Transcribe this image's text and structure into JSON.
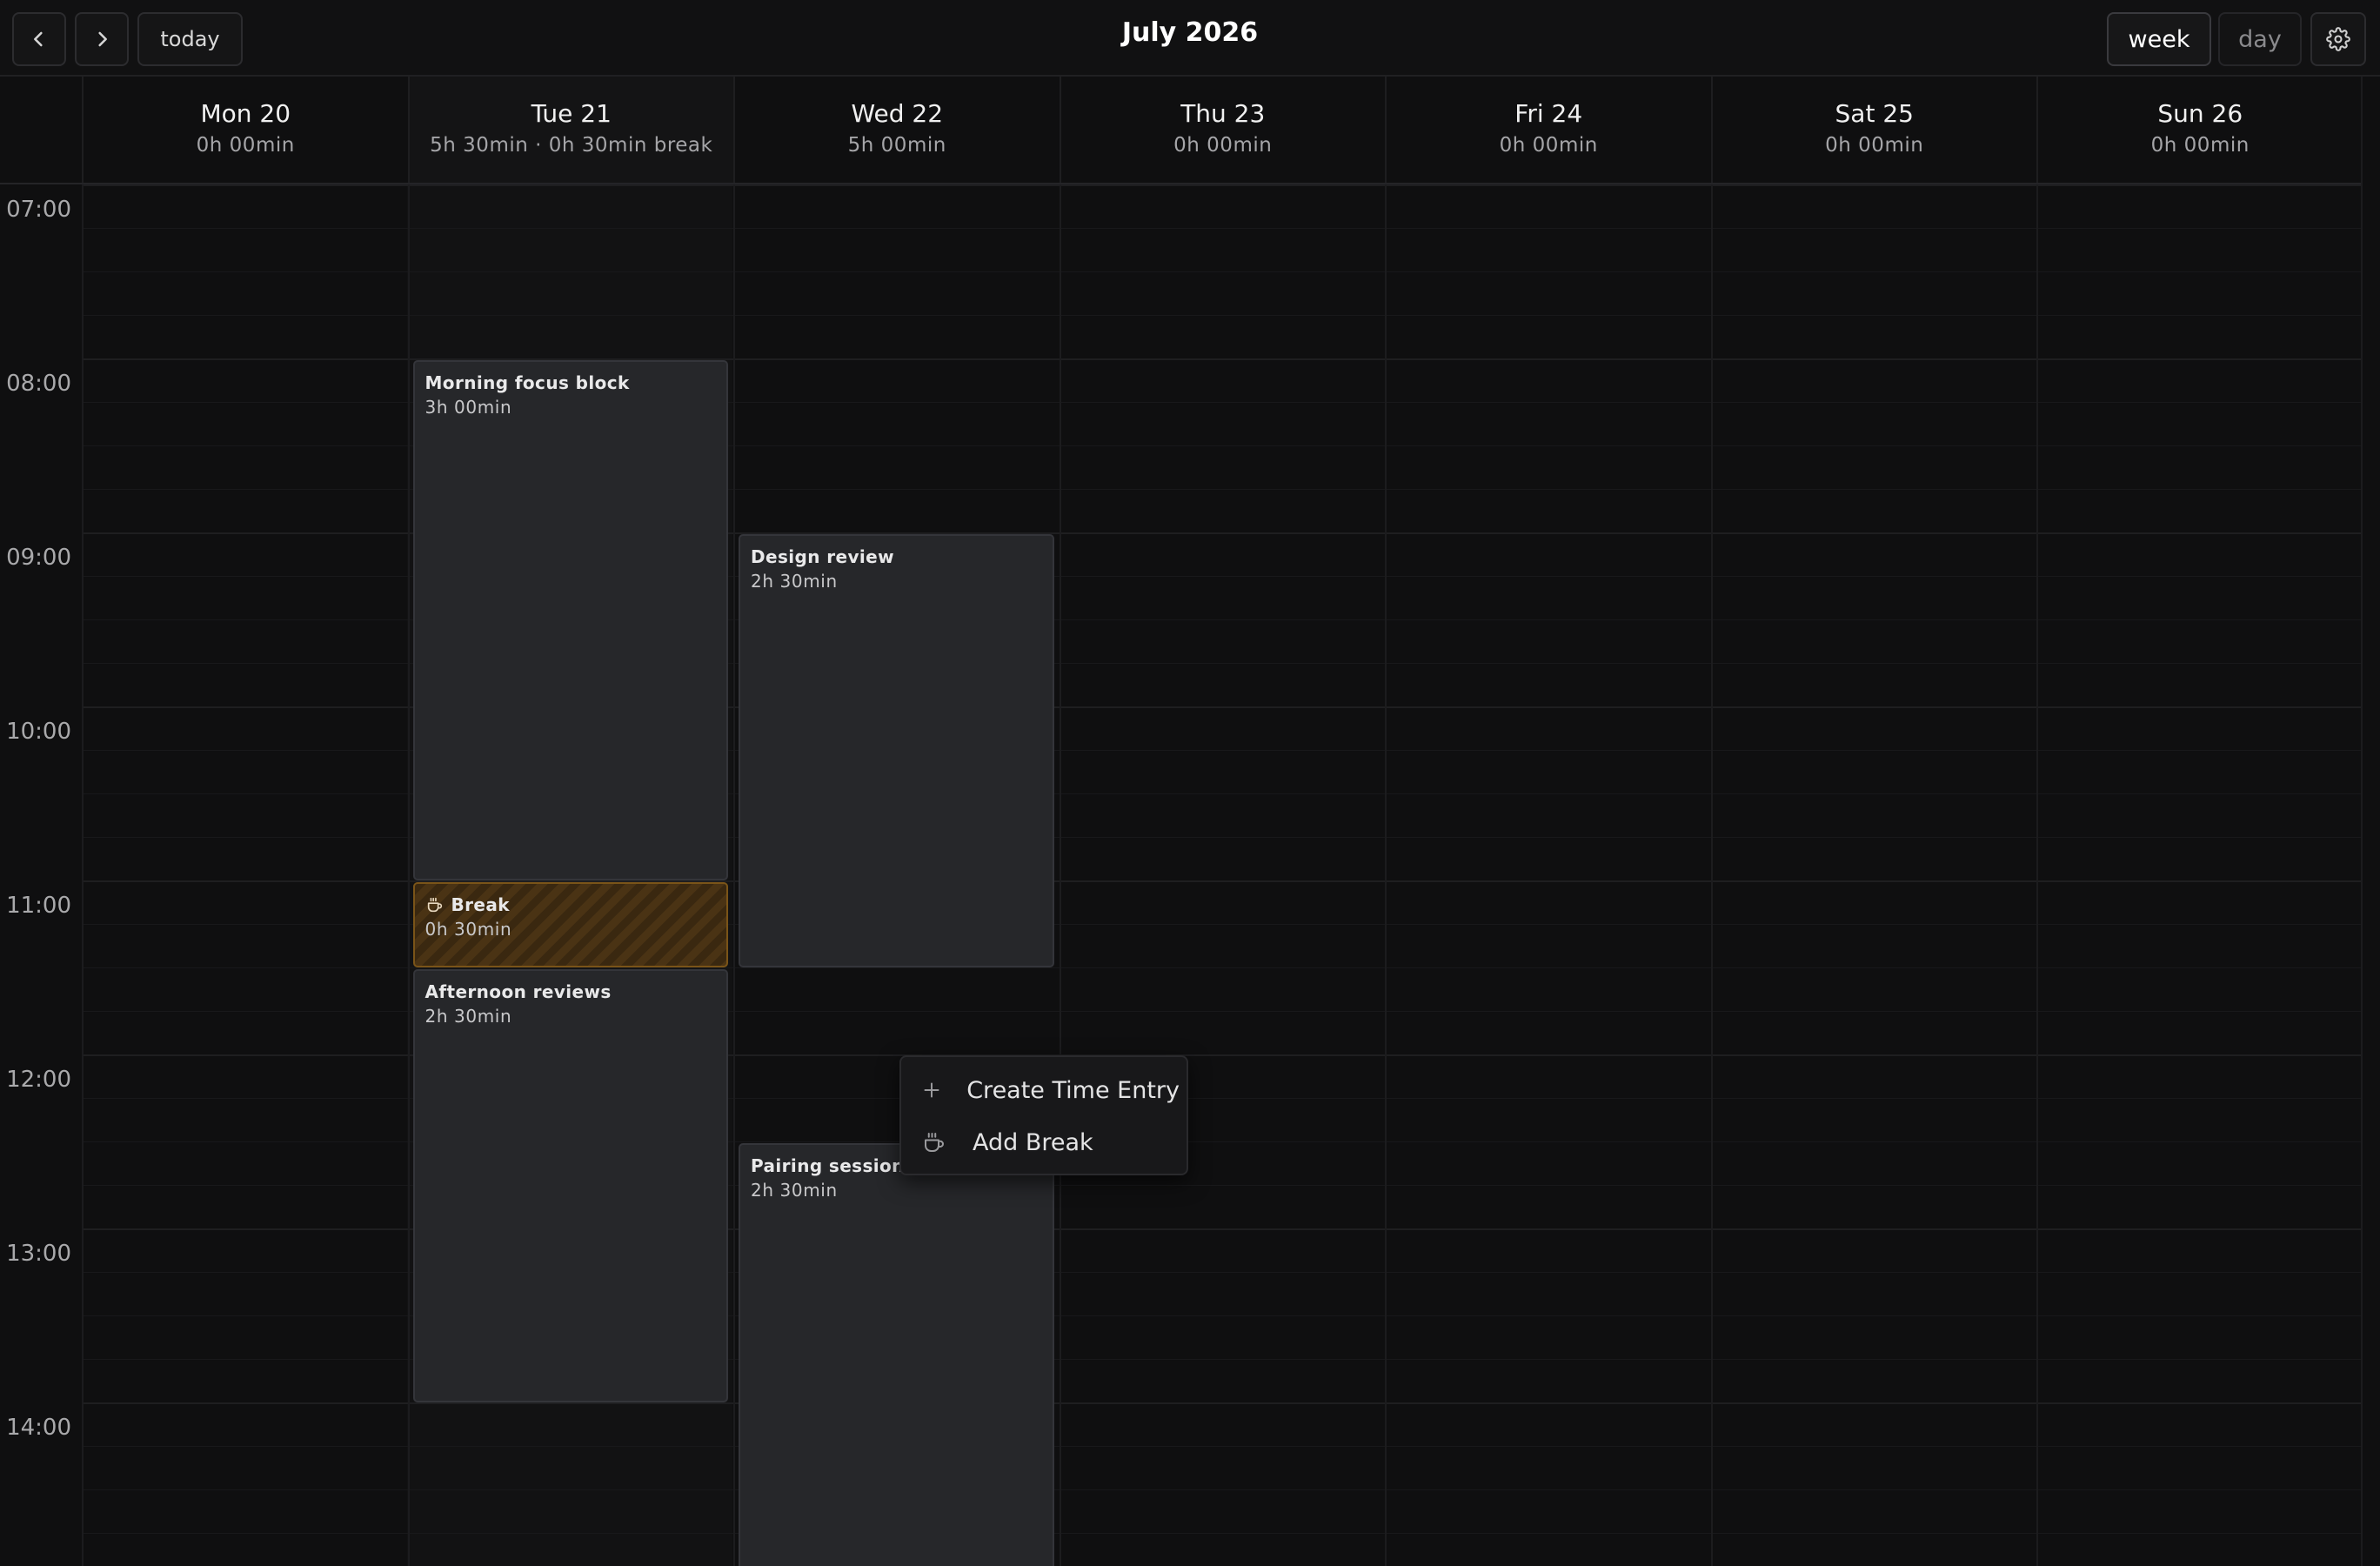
{
  "header": {
    "prev_icon": "chevron-left-icon",
    "next_icon": "chevron-right-icon",
    "today_label": "today",
    "title": "July 2026",
    "view_week_label": "week",
    "view_day_label": "day",
    "active_view": "week",
    "settings_icon": "gear-icon"
  },
  "days": [
    {
      "label": "Mon 20",
      "summary": "0h 00min"
    },
    {
      "label": "Tue 21",
      "summary": "5h 30min · 0h 30min break",
      "today": true
    },
    {
      "label": "Wed 22",
      "summary": "5h 00min"
    },
    {
      "label": "Thu 23",
      "summary": "0h 00min"
    },
    {
      "label": "Fri 24",
      "summary": "0h 00min"
    },
    {
      "label": "Sat 25",
      "summary": "0h 00min"
    },
    {
      "label": "Sun 26",
      "summary": "0h 00min"
    }
  ],
  "hours": [
    "07:00",
    "08:00",
    "09:00",
    "10:00",
    "11:00",
    "12:00",
    "13:00",
    "14:00"
  ],
  "entries": [
    {
      "day": "Tue 21",
      "title": "Morning focus block",
      "duration": "3h 00min",
      "start": "08:00",
      "end": "11:00"
    },
    {
      "day": "Tue 21",
      "title": "Break",
      "duration": "0h 30min",
      "start": "11:00",
      "end": "11:30",
      "is_break": true,
      "icon": "coffee-cup-icon"
    },
    {
      "day": "Tue 21",
      "title": "Afternoon reviews",
      "duration": "2h 30min",
      "start": "11:30",
      "end": "14:00"
    },
    {
      "day": "Wed 22",
      "title": "Design review",
      "duration": "2h 30min",
      "start": "09:00",
      "end": "11:30"
    },
    {
      "day": "Wed 22",
      "title": "Pairing session",
      "duration": "2h 30min",
      "start": "12:30",
      "end": "15:00"
    }
  ],
  "context_menu": {
    "items": [
      {
        "label": "Create Time Entry",
        "icon": "plus-icon"
      },
      {
        "label": "Add Break",
        "icon": "coffee-cup-icon"
      }
    ]
  },
  "colors": {
    "background": "#0f0f10",
    "entry_bg": "#26272a",
    "entry_border": "#34353a",
    "break_stripe": "#3a2810",
    "break_border": "#7a5418"
  }
}
